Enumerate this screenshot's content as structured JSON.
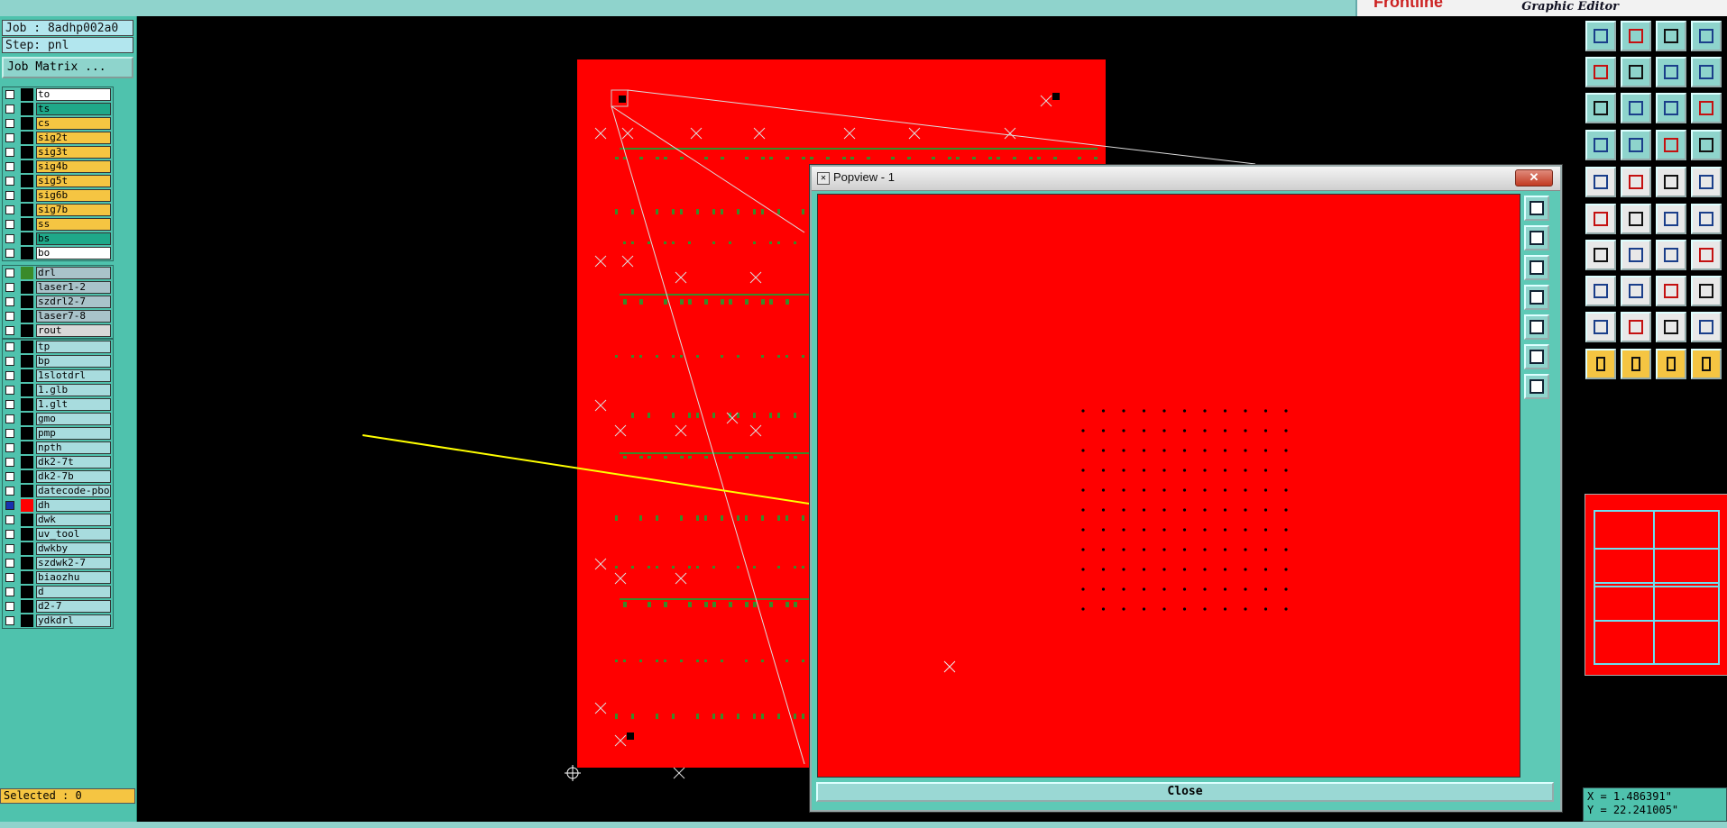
{
  "header": {
    "product_title": "Graphic Editor",
    "logo_text": "Frontline"
  },
  "job_info": {
    "job": "Job : 8adhp002a0",
    "step": "Step: pnl",
    "job_matrix_button": "Job Matrix ..."
  },
  "layer_groups": [
    [
      {
        "name": "to",
        "color": "#ffffff"
      },
      {
        "name": "ts",
        "color": "#1fa889"
      },
      {
        "name": "cs",
        "color": "#f5c542"
      },
      {
        "name": "sig2t",
        "color": "#f5c542"
      },
      {
        "name": "sig3t",
        "color": "#f5c542"
      },
      {
        "name": "sig4b",
        "color": "#f5c542"
      },
      {
        "name": "sig5t",
        "color": "#f5c542"
      },
      {
        "name": "sig6b",
        "color": "#f5c542"
      },
      {
        "name": "sig7b",
        "color": "#f5c542"
      },
      {
        "name": "ss",
        "color": "#f5c542"
      },
      {
        "name": "bs",
        "color": "#1fa889"
      },
      {
        "name": "bo",
        "color": "#ffffff"
      }
    ],
    [
      {
        "name": "drl",
        "color": "#a9c3ca",
        "swatch": "#3a8a2a"
      },
      {
        "name": "laser1-2",
        "color": "#a9c3ca"
      },
      {
        "name": "szdrl2-7",
        "color": "#a9c3ca"
      },
      {
        "name": "laser7-8",
        "color": "#a9c3ca"
      },
      {
        "name": "rout",
        "color": "#d8d8d8"
      }
    ],
    [
      {
        "name": "tp",
        "color": "#a8dcde"
      },
      {
        "name": "bp",
        "color": "#a8dcde"
      },
      {
        "name": "1slotdrl",
        "color": "#a8dcde"
      },
      {
        "name": "1.glb",
        "color": "#a8dcde"
      },
      {
        "name": "1.glt",
        "color": "#a8dcde"
      },
      {
        "name": "gmo",
        "color": "#a8dcde"
      },
      {
        "name": "pmp",
        "color": "#a8dcde"
      },
      {
        "name": "npth",
        "color": "#a8dcde"
      },
      {
        "name": "dk2-7t",
        "color": "#a8dcde"
      },
      {
        "name": "dk2-7b",
        "color": "#a8dcde"
      },
      {
        "name": "datecode-pbo",
        "color": "#a8dcde"
      },
      {
        "name": "dh",
        "color": "#a8dcde",
        "swatch": "#ff0000",
        "checked": true
      },
      {
        "name": "dwk",
        "color": "#a8dcde"
      },
      {
        "name": "uv_tool",
        "color": "#a8dcde"
      },
      {
        "name": "dwkby",
        "color": "#a8dcde"
      },
      {
        "name": "szdwk2-7",
        "color": "#a8dcde"
      },
      {
        "name": "biaozhu",
        "color": "#a8dcde"
      },
      {
        "name": "d",
        "color": "#a8dcde"
      },
      {
        "name": "d2-7",
        "color": "#a8dcde"
      },
      {
        "name": "ydkdrl",
        "color": "#a8dcde"
      }
    ]
  ],
  "status": {
    "selected": "Selected : 0",
    "x": "X = 1.486391\"",
    "y": "Y = 22.241005\""
  },
  "popview": {
    "title": "Popview - 1",
    "close_label": "Close",
    "close_x": "✕"
  },
  "colors": {
    "board": "#ff0000",
    "panel": "#4fc2ad",
    "arrow": "#ffff00",
    "pads": "#3a8a2a"
  }
}
